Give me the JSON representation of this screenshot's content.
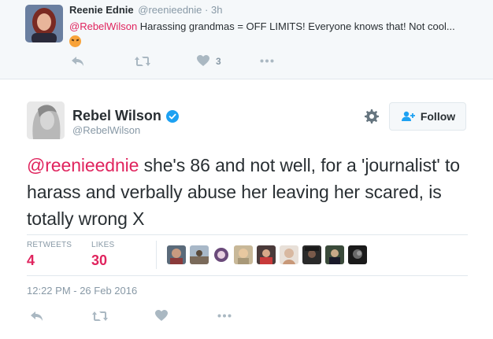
{
  "reply": {
    "name": "Reenie Ednie",
    "handle": "@reenieednie · 3h",
    "mention": "@RebelWilson",
    "text": " Harassing grandmas = OFF LIMITS! Everyone knows that! Not cool...",
    "emoji": "angry-face-emoji",
    "like_count": "3"
  },
  "tweet": {
    "name": "Rebel Wilson",
    "handle": "@RebelWilson",
    "follow_label": "Follow",
    "mention": "@reenieednie",
    "text": " she's 86 and not well, for a 'journalist' to harass and verbally abuse her leaving her scared, is totally wrong X",
    "retweets_label": "RETWEETS",
    "retweets": "4",
    "likes_label": "LIKES",
    "likes": "30",
    "timestamp": "12:22 PM - 26 Feb 2016"
  },
  "colors": {
    "mention": "#e0245e",
    "verified": "#1da1f2",
    "muted": "#8899a6",
    "icon": "#aab8c2"
  },
  "icons": [
    "reply-icon",
    "retweet-icon",
    "heart-icon",
    "more-icon",
    "gear-icon",
    "follow-user-icon",
    "verified-badge-icon"
  ]
}
